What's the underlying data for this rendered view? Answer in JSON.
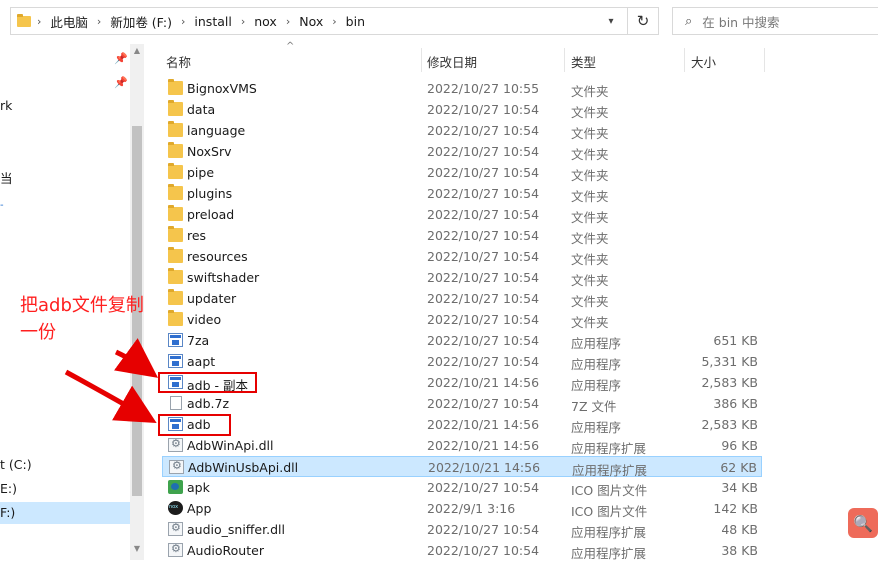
{
  "address": {
    "crumbs": [
      "此电脑",
      "新加卷 (F:)",
      "install",
      "nox",
      "Nox",
      "bin"
    ],
    "search_placeholder": "在 bin 中搜索"
  },
  "nav": {
    "items": [
      {
        "label": "rk"
      },
      {
        "label": "当"
      },
      {
        "label": "t (C:)"
      },
      {
        "label": "E:)"
      },
      {
        "label": "F:)"
      }
    ]
  },
  "columns": {
    "name": "名称",
    "date": "修改日期",
    "type": "类型",
    "size": "大小"
  },
  "files": [
    {
      "name": "BignoxVMS",
      "date": "2022/10/27 10:55",
      "type": "文件夹",
      "size": "",
      "icon": "folder-icon"
    },
    {
      "name": "data",
      "date": "2022/10/27 10:54",
      "type": "文件夹",
      "size": "",
      "icon": "folder-icon"
    },
    {
      "name": "language",
      "date": "2022/10/27 10:54",
      "type": "文件夹",
      "size": "",
      "icon": "folder-icon"
    },
    {
      "name": "NoxSrv",
      "date": "2022/10/27 10:54",
      "type": "文件夹",
      "size": "",
      "icon": "folder-icon"
    },
    {
      "name": "pipe",
      "date": "2022/10/27 10:54",
      "type": "文件夹",
      "size": "",
      "icon": "folder-icon"
    },
    {
      "name": "plugins",
      "date": "2022/10/27 10:54",
      "type": "文件夹",
      "size": "",
      "icon": "folder-icon"
    },
    {
      "name": "preload",
      "date": "2022/10/27 10:54",
      "type": "文件夹",
      "size": "",
      "icon": "folder-icon"
    },
    {
      "name": "res",
      "date": "2022/10/27 10:54",
      "type": "文件夹",
      "size": "",
      "icon": "folder-icon"
    },
    {
      "name": "resources",
      "date": "2022/10/27 10:54",
      "type": "文件夹",
      "size": "",
      "icon": "folder-icon"
    },
    {
      "name": "swiftshader",
      "date": "2022/10/27 10:54",
      "type": "文件夹",
      "size": "",
      "icon": "folder-icon"
    },
    {
      "name": "updater",
      "date": "2022/10/27 10:54",
      "type": "文件夹",
      "size": "",
      "icon": "folder-icon"
    },
    {
      "name": "video",
      "date": "2022/10/27 10:54",
      "type": "文件夹",
      "size": "",
      "icon": "folder-icon"
    },
    {
      "name": "7za",
      "date": "2022/10/27 10:54",
      "type": "应用程序",
      "size": "651 KB",
      "icon": "exe-icon"
    },
    {
      "name": "aapt",
      "date": "2022/10/27 10:54",
      "type": "应用程序",
      "size": "5,331 KB",
      "icon": "exe-icon"
    },
    {
      "name": "adb - 副本",
      "date": "2022/10/21 14:56",
      "type": "应用程序",
      "size": "2,583 KB",
      "icon": "exe-icon"
    },
    {
      "name": "adb.7z",
      "date": "2022/10/27 10:54",
      "type": "7Z 文件",
      "size": "386 KB",
      "icon": "file-icon"
    },
    {
      "name": "adb",
      "date": "2022/10/21 14:56",
      "type": "应用程序",
      "size": "2,583 KB",
      "icon": "exe-icon"
    },
    {
      "name": "AdbWinApi.dll",
      "date": "2022/10/21 14:56",
      "type": "应用程序扩展",
      "size": "96 KB",
      "icon": "dll-icon"
    },
    {
      "name": "AdbWinUsbApi.dll",
      "date": "2022/10/21 14:56",
      "type": "应用程序扩展",
      "size": "62 KB",
      "icon": "dll-icon",
      "selected": true
    },
    {
      "name": "apk",
      "date": "2022/10/27 10:54",
      "type": "ICO 图片文件",
      "size": "34 KB",
      "icon": "image-icon"
    },
    {
      "name": "App",
      "date": "2022/9/1 3:16",
      "type": "ICO 图片文件",
      "size": "142 KB",
      "icon": "nox-icon"
    },
    {
      "name": "audio_sniffer.dll",
      "date": "2022/10/27 10:54",
      "type": "应用程序扩展",
      "size": "48 KB",
      "icon": "dll-icon"
    },
    {
      "name": "AudioRouter",
      "date": "2022/10/27 10:54",
      "type": "应用程序扩展",
      "size": "38 KB",
      "icon": "dll-icon"
    }
  ],
  "annotation": {
    "text_line1": "把adb文件复制",
    "text_line2": "一份"
  },
  "colors": {
    "annotation": "#ff1f1f",
    "selection": "#cce8ff",
    "folder": "#f5c54c"
  }
}
